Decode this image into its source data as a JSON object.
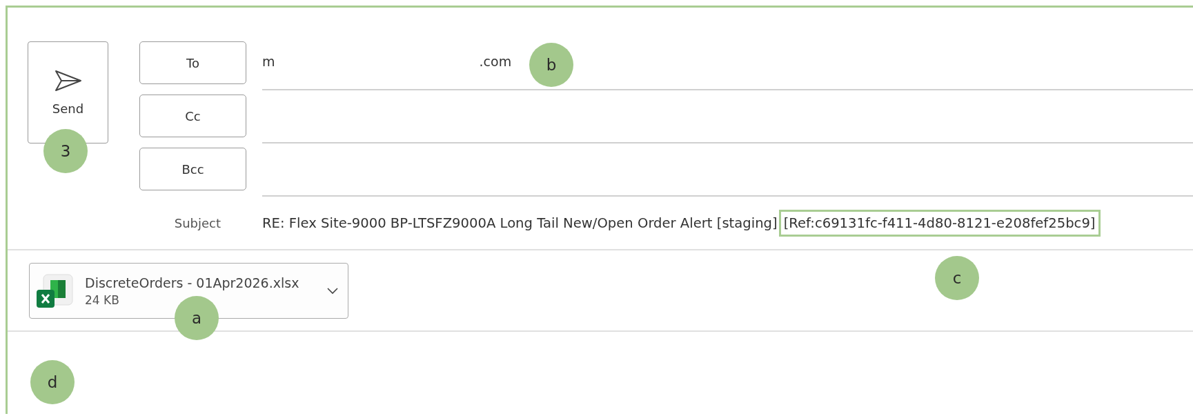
{
  "send_button": {
    "label": "Send"
  },
  "recipients": [
    {
      "button": "To",
      "value_start": "m",
      "value_end": ".com"
    },
    {
      "button": "Cc"
    },
    {
      "button": "Bcc"
    }
  ],
  "subject": {
    "label": "Subject",
    "text": "RE: Flex Site-9000 BP-LTSFZ9000A Long Tail New/Open Order Alert [staging] ",
    "reference": "[Ref:c69131fc-f411-4d80-8121-e208fef25bc9]",
    "reference_highlighted": true
  },
  "attachment": {
    "name": "DiscreteOrders - 01Apr2026.xlsx",
    "size": "24 KB"
  },
  "annotations": [
    {
      "label": "3"
    },
    {
      "label": "b"
    },
    {
      "label": "c"
    },
    {
      "label": "a"
    },
    {
      "label": "d"
    }
  ]
}
